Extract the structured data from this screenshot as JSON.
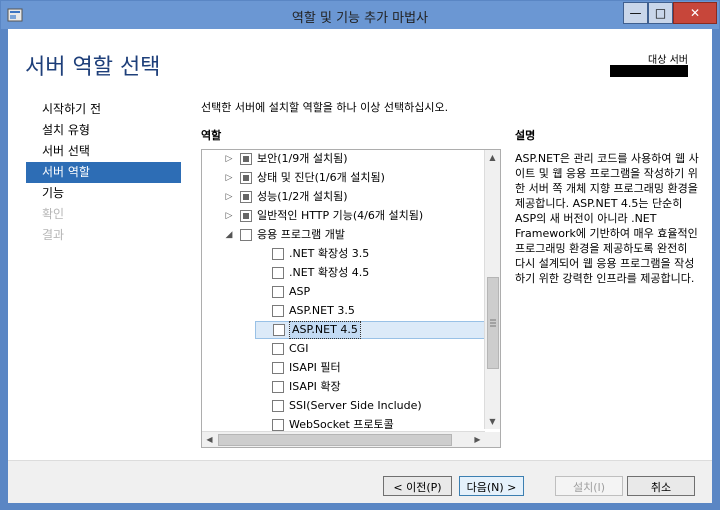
{
  "window": {
    "title": "역할 및 기능 추가 마법사"
  },
  "controls": {
    "minimize": "—",
    "maximize": "□",
    "close": "✕"
  },
  "header": {
    "page_title": "서버 역할 선택",
    "destination_label": "대상 서버"
  },
  "nav": [
    {
      "label": "시작하기 전",
      "state": "normal"
    },
    {
      "label": "설치 유형",
      "state": "normal"
    },
    {
      "label": "서버 선택",
      "state": "normal"
    },
    {
      "label": "서버 역할",
      "state": "active"
    },
    {
      "label": "기능",
      "state": "normal"
    },
    {
      "label": "확인",
      "state": "disabled"
    },
    {
      "label": "결과",
      "state": "disabled"
    }
  ],
  "main": {
    "instruction": "선택한 서버에 설치할 역할을 하나 이상 선택하십시오.",
    "roles_label": "역할",
    "description_label": "설명",
    "description": "ASP.NET은 관리 코드를 사용하여 웹 사이트 및 웹 응용 프로그램을 작성하기 위한 서버 쪽 개체 지향 프로그래밍 환경을 제공합니다. ASP.NET 4.5는 단순히 ASP의 새 버전이 아니라 .NET Framework에 기반하여 매우 효율적인 프로그래밍 환경을 제공하도록 완전히 다시 설계되어 웹 응용 프로그램을 작성하기 위한 강력한 인프라를 제공합니다."
  },
  "tree": [
    {
      "label": "보안(1/9개 설치됨)",
      "level": 0,
      "expander": "collapsed",
      "check": "partial"
    },
    {
      "label": "상태 및 진단(1/6개 설치됨)",
      "level": 0,
      "expander": "collapsed",
      "check": "partial"
    },
    {
      "label": "성능(1/2개 설치됨)",
      "level": 0,
      "expander": "collapsed",
      "check": "partial"
    },
    {
      "label": "일반적인 HTTP 기능(4/6개 설치됨)",
      "level": 0,
      "expander": "collapsed",
      "check": "partial"
    },
    {
      "label": "응용 프로그램 개발",
      "level": 0,
      "expander": "expanded",
      "check": "unchecked"
    },
    {
      "label": ".NET 확장성 3.5",
      "level": 1,
      "check": "unchecked"
    },
    {
      "label": ".NET 확장성 4.5",
      "level": 1,
      "check": "unchecked"
    },
    {
      "label": "ASP",
      "level": 1,
      "check": "unchecked"
    },
    {
      "label": "ASP.NET 3.5",
      "level": 1,
      "check": "unchecked"
    },
    {
      "label": "ASP.NET 4.5",
      "level": 1,
      "check": "unchecked",
      "selected": true
    },
    {
      "label": "CGI",
      "level": 1,
      "check": "unchecked"
    },
    {
      "label": "ISAPI 필터",
      "level": 1,
      "check": "unchecked"
    },
    {
      "label": "ISAPI 확장",
      "level": 1,
      "check": "unchecked"
    },
    {
      "label": "SSI(Server Side Include)",
      "level": 1,
      "check": "unchecked"
    },
    {
      "label": "WebSocket 프로토콜",
      "level": 1,
      "check": "unchecked"
    }
  ],
  "footer": {
    "prev": "< 이전(P)",
    "next": "다음(N) >",
    "install": "설치(I)",
    "cancel": "취소"
  },
  "colors": {
    "titlebar": "#6b97d3",
    "nav_active": "#2d6db5",
    "title_text": "#1e3f7a",
    "selection": "#c3dbf4"
  },
  "icons": [
    "app-icon",
    "minimize-icon",
    "maximize-icon",
    "close-icon",
    "expand-arrow-icon",
    "collapse-arrow-icon",
    "scroll-up-icon",
    "scroll-down-icon",
    "scroll-left-icon",
    "scroll-right-icon",
    "scroll-grip-icon"
  ]
}
